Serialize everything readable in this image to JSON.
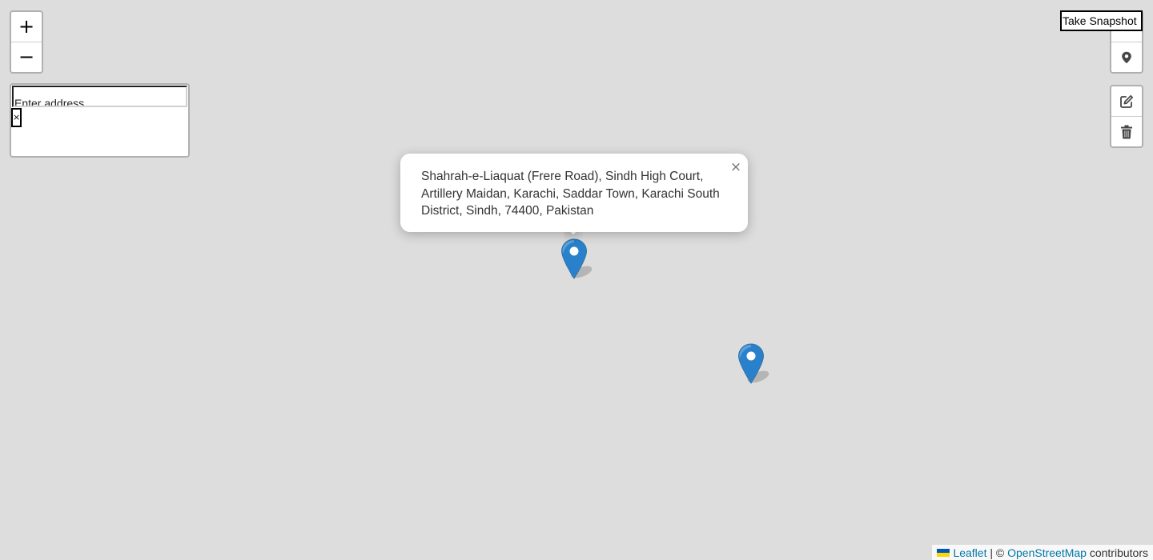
{
  "zoom": {
    "in_label": "+",
    "out_label": "−"
  },
  "geocoder": {
    "input_value": "Enter address",
    "clear_label": "×"
  },
  "toolbar": {
    "snapshot_label": "Take Snapshot",
    "locate_icon": "map-pin-icon",
    "edit_icon": "edit-icon",
    "delete_icon": "trash-icon"
  },
  "popup": {
    "text": "Shahrah-e-Liaquat (Frere Road), Sindh High Court, Artillery Maidan, Karachi, Saddar Town, Karachi South District, Sindh, 74400, Pakistan",
    "close_label": "×"
  },
  "markers": [
    {
      "name": "marker-1",
      "color": "#2a81cb"
    },
    {
      "name": "marker-2",
      "color": "#2a81cb"
    }
  ],
  "attribution": {
    "leaflet_label": "Leaflet",
    "separator": "| ©",
    "osm_label": "OpenStreetMap",
    "contributors": "contributors",
    "flag_colors": [
      "#0057b7",
      "#ffd700"
    ]
  },
  "colors": {
    "map_background": "#dddddd",
    "link": "#0078a8",
    "marker": "#2a81cb"
  }
}
